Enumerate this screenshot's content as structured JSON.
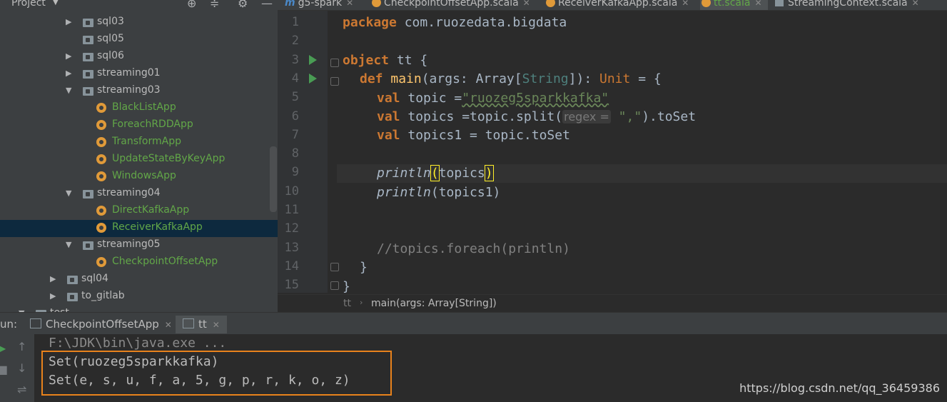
{
  "project": {
    "title": "Project",
    "tree": [
      {
        "label": "sql03",
        "type": "folder",
        "expanded": false,
        "level": 1
      },
      {
        "label": "sql05",
        "type": "folder",
        "expanded": null,
        "level": 1
      },
      {
        "label": "sql06",
        "type": "folder",
        "expanded": false,
        "level": 1
      },
      {
        "label": "streaming01",
        "type": "folder",
        "expanded": false,
        "level": 1
      },
      {
        "label": "streaming03",
        "type": "folder",
        "expanded": true,
        "level": 1
      },
      {
        "label": "BlackListApp",
        "type": "object",
        "level": 2
      },
      {
        "label": "ForeachRDDApp",
        "type": "object",
        "level": 2
      },
      {
        "label": "TransformApp",
        "type": "object",
        "level": 2
      },
      {
        "label": "UpdateStateByKeyApp",
        "type": "object",
        "level": 2
      },
      {
        "label": "WindowsApp",
        "type": "object",
        "level": 2
      },
      {
        "label": "streaming04",
        "type": "folder",
        "expanded": true,
        "level": 1
      },
      {
        "label": "DirectKafkaApp",
        "type": "object",
        "level": 2
      },
      {
        "label": "ReceiverKafkaApp",
        "type": "object",
        "level": 2,
        "selected": true
      },
      {
        "label": "streaming05",
        "type": "folder",
        "expanded": true,
        "level": 1
      },
      {
        "label": "CheckpointOffsetApp",
        "type": "object",
        "level": 2
      },
      {
        "label": "sql04",
        "type": "folder",
        "expanded": false,
        "level": 0
      },
      {
        "label": "to_gitlab",
        "type": "folder",
        "expanded": false,
        "level": 0
      },
      {
        "label": "test",
        "type": "folder",
        "expanded": true,
        "level": -1
      }
    ]
  },
  "tabs": [
    {
      "label": "g5-spark",
      "icon": "m-icon",
      "active": false
    },
    {
      "label": "CheckpointOffsetApp.scala",
      "icon": "object-icon",
      "active": false
    },
    {
      "label": "ReceiverKafkaApp.scala",
      "icon": "object-icon",
      "active": false
    },
    {
      "label": "tt.scala",
      "icon": "object-icon",
      "active": true
    },
    {
      "label": "StreamingContext.scala",
      "icon": "class-icon",
      "active": false
    }
  ],
  "editor": {
    "line_numbers": [
      "1",
      "2",
      "3",
      "4",
      "5",
      "6",
      "7",
      "8",
      "9",
      "10",
      "11",
      "12",
      "13",
      "14",
      "15"
    ],
    "code": {
      "l1_kw": "package",
      "l1_rest": " com.ruozedata.bigdata",
      "l3_kw": "object",
      "l3_rest": " tt {",
      "l4_kw1": "def ",
      "l4_fn": "main",
      "l4_a": "(args: Array[",
      "l4_type": "String",
      "l4_b": "]): ",
      "l4_unit": "Unit",
      "l4_c": " = {",
      "l5_kw": "val",
      "l5_a": " topic =",
      "l5_str": "\"ruozeg5sparkkafka\"",
      "l6_kw": "val",
      "l6_a": " topics =topic.split(",
      "l6_hint": "regex =",
      "l6_str": " \",\"",
      "l6_b": ").toSet",
      "l7_kw": "val",
      "l7_a": " topics1 = topic.toSet",
      "l9_fn": "println",
      "l9_open": "(",
      "l9_arg": "topics",
      "l9_close": ")",
      "l10_fn": "println",
      "l10_rest": "(topics1)",
      "l13_cmt": "//topics.foreach(println)",
      "l14": "}",
      "l15": "}"
    }
  },
  "breadcrumb": {
    "item1": "tt",
    "separator": "›",
    "item2": "main(args: Array[String])"
  },
  "run": {
    "label": "un:",
    "tabs": [
      {
        "label": "CheckpointOffsetApp"
      },
      {
        "label": "tt"
      }
    ],
    "console": [
      "F:\\JDK\\bin\\java.exe ...",
      "Set(ruozeg5sparkkafka)",
      "Set(e, s, u, f, a, 5, g, p, r, k, o, z)"
    ]
  },
  "watermark": "https://blog.csdn.net/qq_36459386",
  "colors": {
    "keyword": "#cc7832",
    "string": "#6a8759",
    "function": "#ffc66d",
    "green_label": "#62a748",
    "highlight_box": "#e8821c"
  }
}
